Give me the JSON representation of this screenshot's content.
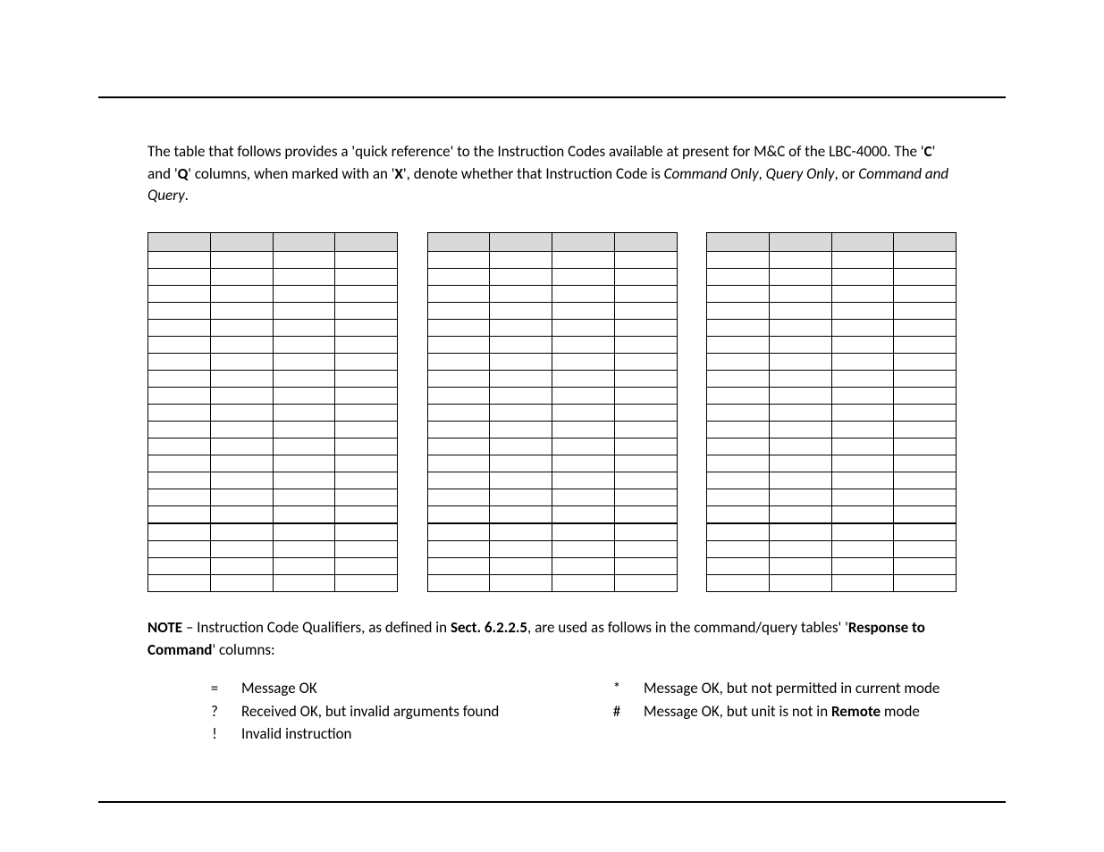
{
  "intro": {
    "t1": "The table that follows provides a 'quick reference' to the Instruction Codes available at present for M&C of the LBC-4000. The '",
    "b1": "C",
    "t2": "' and '",
    "b2": "Q",
    "t3": "' columns, when marked with an '",
    "b3": "X",
    "t4": "', denote whether that Instruction Code is ",
    "i1": "Command Only",
    "t5": ", ",
    "i2": "Query Only",
    "t6": ", or ",
    "i3": "Command and Query",
    "t7": "."
  },
  "note": {
    "bold1": "NOTE",
    "t1": " – Instruction Code Qualifiers, as defined in ",
    "bold2": "Sect. 6.2.2.5",
    "t2": ", are used as follows in the command/query tables' '",
    "bold3": "Response to Command",
    "t3": "' columns:"
  },
  "qualifiers": {
    "left": [
      {
        "sym": "=",
        "desc_pre": "Message OK",
        "desc_bold": "",
        "desc_post": ""
      },
      {
        "sym": "?",
        "desc_pre": "Received OK, but invalid arguments found",
        "desc_bold": "",
        "desc_post": ""
      },
      {
        "sym": "!",
        "desc_pre": "Invalid instruction",
        "desc_bold": "",
        "desc_post": ""
      }
    ],
    "right": [
      {
        "sym": "*",
        "desc_pre": "Message OK, but not permitted in current mode",
        "desc_bold": "",
        "desc_post": ""
      },
      {
        "sym": "#",
        "desc_pre": "Message OK, but unit is not in ",
        "desc_bold": "Remote",
        "desc_post": " mode"
      }
    ]
  },
  "tables": {
    "columns": 4,
    "body_rows": 20,
    "header_cells": [
      "",
      "",
      "",
      ""
    ],
    "separator_row_index": 16
  }
}
